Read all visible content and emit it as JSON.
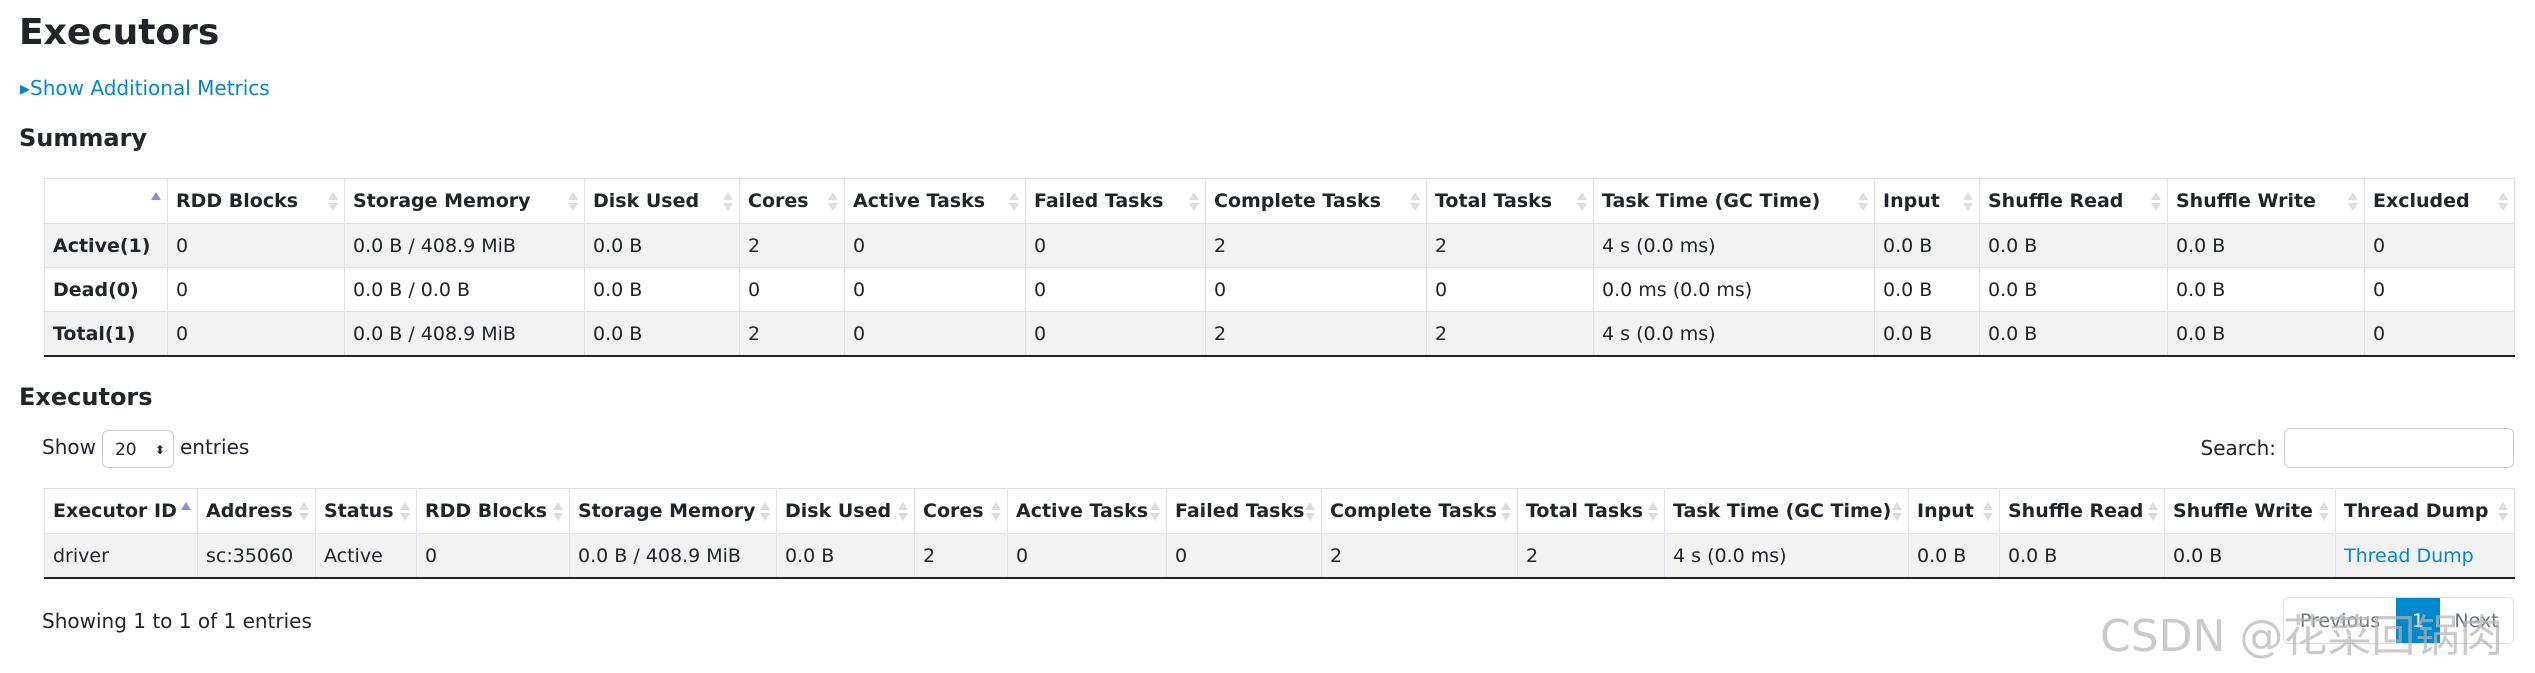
{
  "title": "Executors",
  "show_metrics": "Show Additional Metrics",
  "summary": {
    "title": "Summary",
    "headers": [
      "",
      "RDD Blocks",
      "Storage Memory",
      "Disk Used",
      "Cores",
      "Active Tasks",
      "Failed Tasks",
      "Complete Tasks",
      "Total Tasks",
      "Task Time (GC Time)",
      "Input",
      "Shuffle Read",
      "Shuffle Write",
      "Excluded"
    ],
    "rows": [
      [
        "Active(1)",
        "0",
        "0.0 B / 408.9 MiB",
        "0.0 B",
        "2",
        "0",
        "0",
        "2",
        "2",
        "4 s (0.0 ms)",
        "0.0 B",
        "0.0 B",
        "0.0 B",
        "0"
      ],
      [
        "Dead(0)",
        "0",
        "0.0 B / 0.0 B",
        "0.0 B",
        "0",
        "0",
        "0",
        "0",
        "0",
        "0.0 ms (0.0 ms)",
        "0.0 B",
        "0.0 B",
        "0.0 B",
        "0"
      ],
      [
        "Total(1)",
        "0",
        "0.0 B / 408.9 MiB",
        "0.0 B",
        "2",
        "0",
        "0",
        "2",
        "2",
        "4 s (0.0 ms)",
        "0.0 B",
        "0.0 B",
        "0.0 B",
        "0"
      ]
    ]
  },
  "executors": {
    "title": "Executors",
    "show_label": "Show",
    "entries_value": "20",
    "entries_label": "entries",
    "search_label": "Search:",
    "search_value": "",
    "headers": [
      "Executor ID",
      "Address",
      "Status",
      "RDD Blocks",
      "Storage Memory",
      "Disk Used",
      "Cores",
      "Active Tasks",
      "Failed Tasks",
      "Complete Tasks",
      "Total Tasks",
      "Task Time (GC Time)",
      "Input",
      "Shuffle Read",
      "Shuffle Write",
      "Thread Dump"
    ],
    "rows": [
      [
        "driver",
        "sc:35060",
        "Active",
        "0",
        "0.0 B / 408.9 MiB",
        "0.0 B",
        "2",
        "0",
        "0",
        "2",
        "2",
        "4 s (0.0 ms)",
        "0.0 B",
        "0.0 B",
        "0.0 B",
        "Thread Dump"
      ]
    ],
    "info": "Showing 1 to 1 of 1 entries",
    "pagination": {
      "previous": "Previous",
      "current": "1",
      "next": "Next"
    }
  },
  "watermark": "CSDN @花菜回锅肉",
  "colors": {
    "link": "#0088cc",
    "active_page": "#0088cc"
  }
}
